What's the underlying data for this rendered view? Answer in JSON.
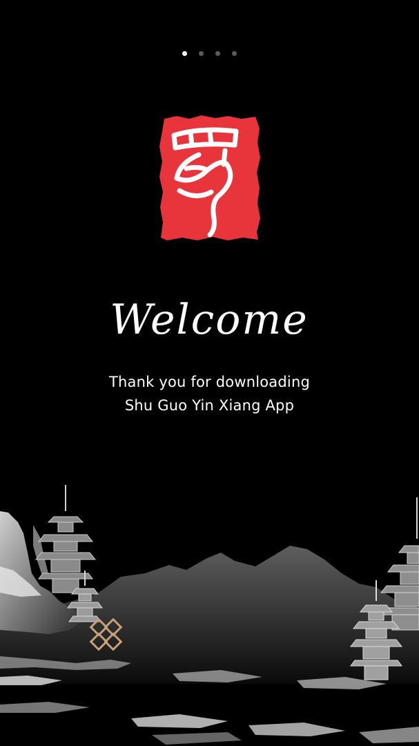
{
  "pager": {
    "total": 4,
    "active_index": 0
  },
  "logo": {
    "icon": "red-seal-logo-icon",
    "color": "#e8343b"
  },
  "welcome": {
    "title": "Welcome"
  },
  "subtitle": {
    "line1": "Thank you for downloading",
    "line2": "Shu Guo Yin Xiang App"
  },
  "decoration": {
    "icon": "ink-landscape-pagoda-icon",
    "knot_color": "#c9a27a"
  }
}
